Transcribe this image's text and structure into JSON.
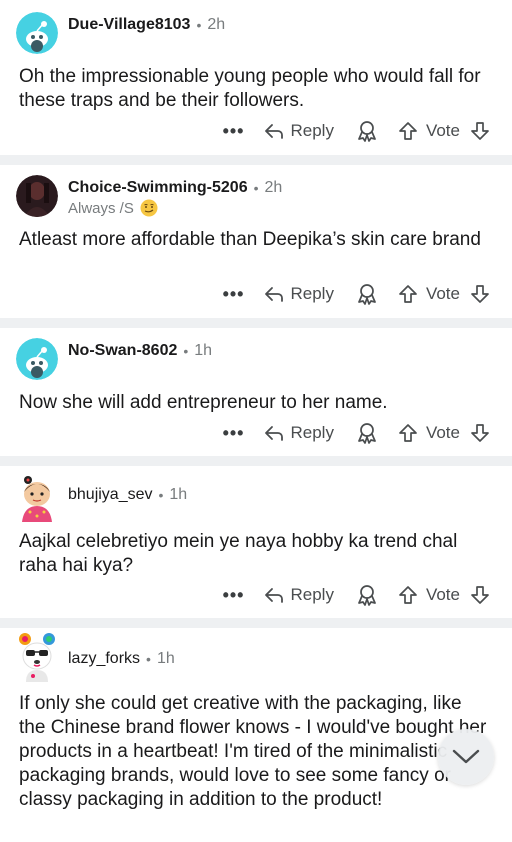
{
  "actions": {
    "more": "•••",
    "reply": "Reply",
    "vote": "Vote"
  },
  "comments": [
    {
      "username": "Due-Village8103",
      "time": "2h",
      "flair": "",
      "body": "Oh the impressionable young people who would fall for these traps and be their followers."
    },
    {
      "username": "Choice-Swimming-5206",
      "time": "2h",
      "flair": "Always /S",
      "body": "Atleast more affordable than Deepika’s skin care brand"
    },
    {
      "username": "No-Swan-8602",
      "time": "1h",
      "flair": "",
      "body": "Now she will add entrepreneur to her name."
    },
    {
      "username": "bhujiya_sev",
      "time": "1h",
      "flair": "",
      "body": "Aajkal celebretiyo mein ye naya hobby ka trend chal raha hai kya?"
    },
    {
      "username": "lazy_forks",
      "time": "1h",
      "flair": "",
      "body": "If only she could get creative with the packaging, like the Chinese brand flower knows - I would've bought her products in a heartbeat! I'm tired of the minimalistic packaging brands, would love to see some fancy or classy packaging in addition to the product!"
    }
  ]
}
